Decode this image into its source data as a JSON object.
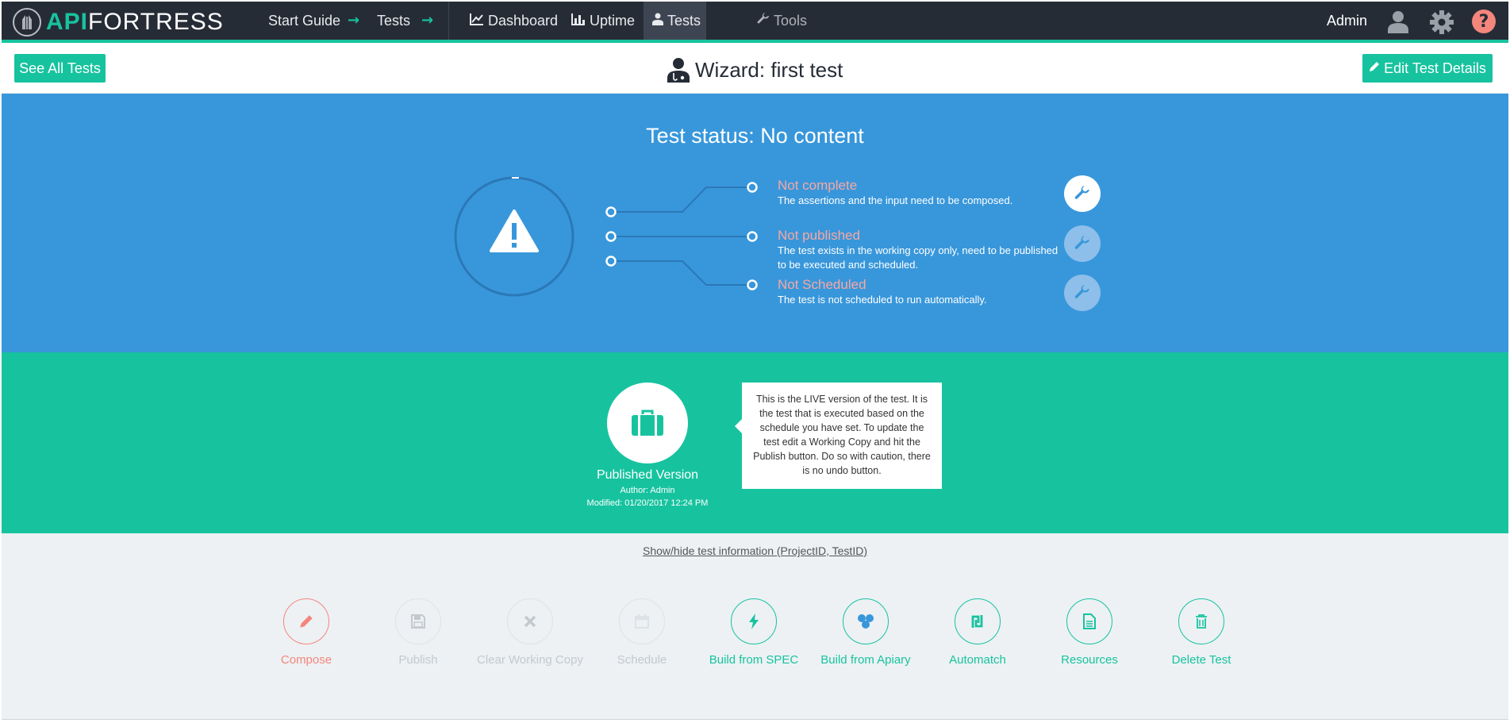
{
  "brand": {
    "prefix": "API",
    "suffix": "FORTRESS"
  },
  "nav": {
    "start_guide": "Start Guide",
    "tests_crumb": "Tests",
    "arrow": "→",
    "dashboard": "Dashboard",
    "uptime": "Uptime",
    "tests": "Tests",
    "tools": "Tools",
    "admin": "Admin",
    "help": "?"
  },
  "titlebar": {
    "see_all": "See All Tests",
    "title": "Wizard: first test",
    "edit": "Edit Test Details"
  },
  "status": {
    "heading": "Test status: No content",
    "items": [
      {
        "title": "Not complete",
        "desc": "The assertions and the input need to be composed.",
        "enabled": true
      },
      {
        "title": "Not published",
        "desc": "The test exists in the working copy only, need to be published to be executed and scheduled.",
        "enabled": false
      },
      {
        "title": "Not Scheduled",
        "desc": "The test is not scheduled to run automatically.",
        "enabled": false
      }
    ]
  },
  "published": {
    "name": "Published Version",
    "author": "Author: Admin",
    "modified": "Modified: 01/20/2017 12:24 PM",
    "tooltip": "This is the LIVE version of the test. It is the test that is executed based on the schedule you have set. To update the test edit a Working Copy and hit the Publish button. Do so with caution, there is no undo button."
  },
  "actions": {
    "info_link": "Show/hide test information (ProjectID, TestID)",
    "buttons": [
      {
        "label": "Compose",
        "state": "red",
        "icon": "pencil-icon"
      },
      {
        "label": "Publish",
        "state": "dim",
        "icon": "floppy-icon"
      },
      {
        "label": "Clear Working Copy",
        "state": "dim",
        "icon": "x-icon"
      },
      {
        "label": "Schedule",
        "state": "dim",
        "icon": "calendar-icon"
      },
      {
        "label": "Build from SPEC",
        "state": "green",
        "icon": "bolt-icon"
      },
      {
        "label": "Build from Apiary",
        "state": "green",
        "icon": "apiary-icon"
      },
      {
        "label": "Automatch",
        "state": "green",
        "icon": "automatch-icon"
      },
      {
        "label": "Resources",
        "state": "green",
        "icon": "document-icon"
      },
      {
        "label": "Delete Test",
        "state": "green",
        "icon": "trash-icon"
      }
    ]
  },
  "colors": {
    "nav_bg": "#262c36",
    "accent": "#17c39f",
    "status_blue": "#3897db",
    "warning_red": "#f4867c"
  }
}
